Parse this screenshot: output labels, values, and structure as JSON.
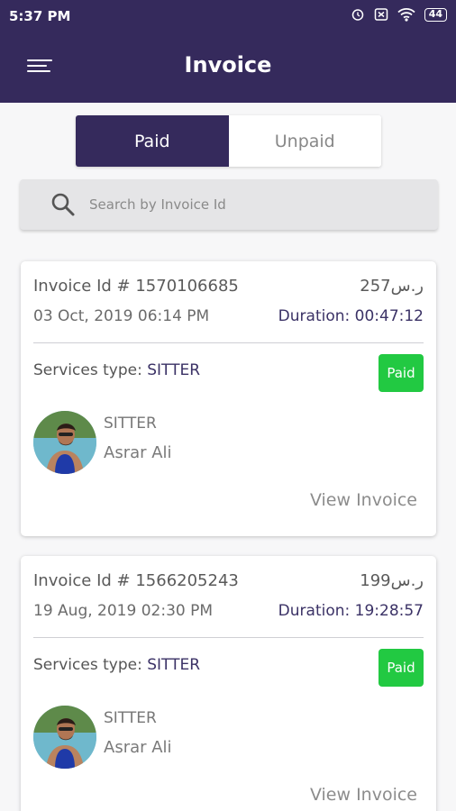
{
  "status_bar": {
    "time": "5:37 PM",
    "battery": "44",
    "icons": [
      "alarm-icon",
      "notification-x-icon",
      "wifi-icon",
      "battery-icon"
    ]
  },
  "header": {
    "title": "Invoice",
    "menu_icon": "hamburger-menu-icon"
  },
  "tabs": [
    {
      "label": "Paid",
      "active": true
    },
    {
      "label": "Unpaid",
      "active": false
    }
  ],
  "search": {
    "placeholder": "Search by Invoice Id",
    "icon": "search-icon"
  },
  "invoices": [
    {
      "id_text": "Invoice Id # 1570106685",
      "amount": "ر.س257",
      "date": "03 Oct, 2019 06:14 PM",
      "duration": "Duration: 00:47:12",
      "service_label": "Services type:",
      "service_value": "SITTER",
      "status": "Paid",
      "provider_role": "SITTER",
      "provider_name": "Asrar Ali",
      "action": "View Invoice"
    },
    {
      "id_text": "Invoice Id # 1566205243",
      "amount": "ر.س199",
      "date": "19 Aug, 2019 02:30 PM",
      "duration": "Duration: 19:28:57",
      "service_label": "Services type:",
      "service_value": "SITTER",
      "status": "Paid",
      "provider_role": "SITTER",
      "provider_name": "Asrar Ali",
      "action": "View Invoice"
    }
  ],
  "colors": {
    "primary": "#352a5c",
    "paid_badge": "#22c942",
    "background": "#f7f7f8"
  }
}
